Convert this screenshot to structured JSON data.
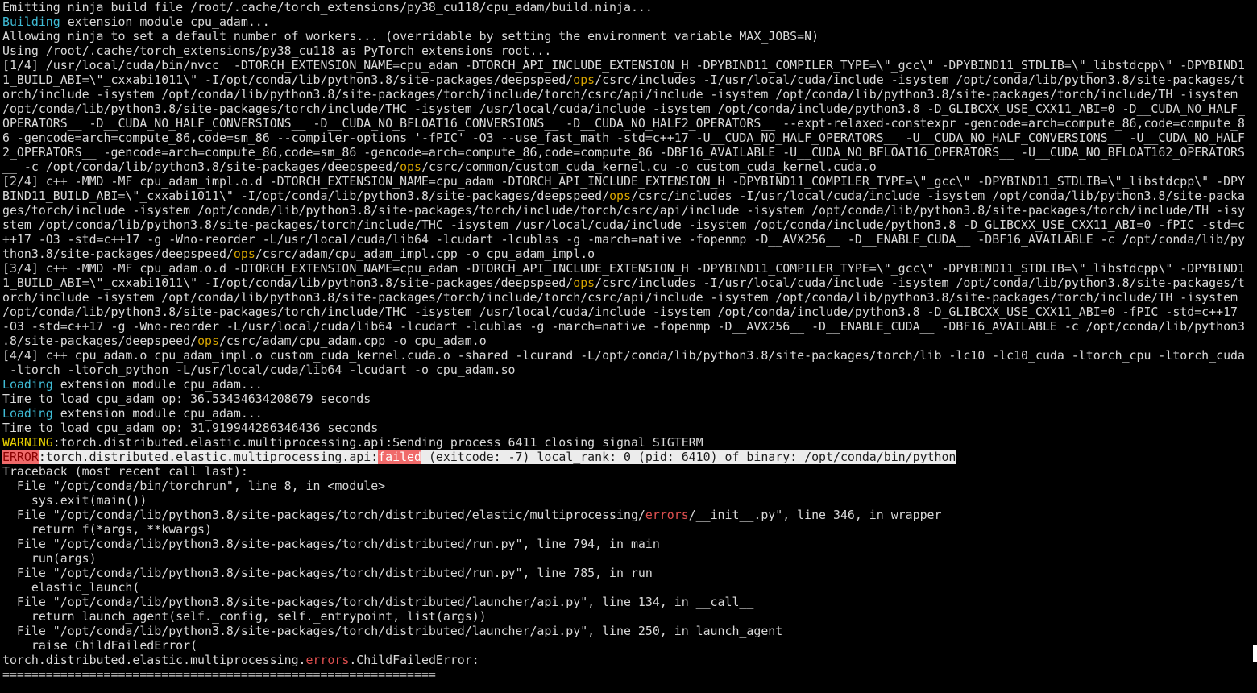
{
  "terminal": {
    "background": "#000000",
    "foreground": "#d9d9d9",
    "colors": {
      "building_loading": "#3fbcd6",
      "ops_keyword": "#d7a500",
      "warning": "#e8d000",
      "error_highlight": "#f06a6a",
      "errors_keyword": "#e05050"
    },
    "lines": [
      {
        "segments": [
          {
            "t": "Emitting ninja build file /root/.cache/torch_extensions/py38_cu118/cpu_adam/build.ninja..."
          }
        ]
      },
      {
        "segments": [
          {
            "t": "Building",
            "c": "cyan"
          },
          {
            "t": " extension module cpu_adam..."
          }
        ]
      },
      {
        "segments": [
          {
            "t": "Allowing ninja to set a default number of workers... (overridable by setting the environment variable MAX_JOBS=N)"
          }
        ]
      },
      {
        "segments": [
          {
            "t": "Using /root/.cache/torch_extensions/py38_cu118 as PyTorch extensions root..."
          }
        ]
      },
      {
        "segments": [
          {
            "t": "[1/4] /usr/local/cuda/bin/nvcc  -DTORCH_EXTENSION_NAME=cpu_adam -DTORCH_API_INCLUDE_EXTENSION_H -DPYBIND11_COMPILER_TYPE=\\\"_gcc\\\" -DPYBIND11_STDLIB=\\\"_libstdcpp\\\" -DPYBIND1"
          }
        ]
      },
      {
        "segments": [
          {
            "t": "1_BUILD_ABI=\\\"_cxxabi1011\\\" -I/opt/conda/lib/python3.8/site-packages/deepspeed/"
          },
          {
            "t": "ops",
            "c": "orange"
          },
          {
            "t": "/csrc/includes -I/usr/local/cuda/include -isystem /opt/conda/lib/python3.8/site-packages/t"
          }
        ]
      },
      {
        "segments": [
          {
            "t": "orch/include -isystem /opt/conda/lib/python3.8/site-packages/torch/include/torch/csrc/api/include -isystem /opt/conda/lib/python3.8/site-packages/torch/include/TH -isystem"
          }
        ]
      },
      {
        "segments": [
          {
            "t": "/opt/conda/lib/python3.8/site-packages/torch/include/THC -isystem /usr/local/cuda/include -isystem /opt/conda/include/python3.8 -D_GLIBCXX_USE_CXX11_ABI=0 -D__CUDA_NO_HALF_"
          }
        ]
      },
      {
        "segments": [
          {
            "t": "OPERATORS__ -D__CUDA_NO_HALF_CONVERSIONS__ -D__CUDA_NO_BFLOAT16_CONVERSIONS__ -D__CUDA_NO_HALF2_OPERATORS__ --expt-relaxed-constexpr -gencode=arch=compute_86,code=compute_8"
          }
        ]
      },
      {
        "segments": [
          {
            "t": "6 -gencode=arch=compute_86,code=sm_86 --compiler-options '-fPIC' -O3 --use_fast_math -std=c++17 -U__CUDA_NO_HALF_OPERATORS__ -U__CUDA_NO_HALF_CONVERSIONS__ -U__CUDA_NO_HALF"
          }
        ]
      },
      {
        "segments": [
          {
            "t": "2_OPERATORS__ -gencode=arch=compute_86,code=sm_86 -gencode=arch=compute_86,code=compute_86 -DBF16_AVAILABLE -U__CUDA_NO_BFLOAT16_OPERATORS__ -U__CUDA_NO_BFLOAT162_OPERATORS"
          }
        ]
      },
      {
        "segments": [
          {
            "t": "__ -c /opt/conda/lib/python3.8/site-packages/deepspeed/"
          },
          {
            "t": "ops",
            "c": "orange"
          },
          {
            "t": "/csrc/common/custom_cuda_kernel.cu -o custom_cuda_kernel.cuda.o"
          }
        ]
      },
      {
        "segments": [
          {
            "t": "[2/4] c++ -MMD -MF cpu_adam_impl.o.d -DTORCH_EXTENSION_NAME=cpu_adam -DTORCH_API_INCLUDE_EXTENSION_H -DPYBIND11_COMPILER_TYPE=\\\"_gcc\\\" -DPYBIND11_STDLIB=\\\"_libstdcpp\\\" -DPY"
          }
        ]
      },
      {
        "segments": [
          {
            "t": "BIND11_BUILD_ABI=\\\"_cxxabi1011\\\" -I/opt/conda/lib/python3.8/site-packages/deepspeed/"
          },
          {
            "t": "ops",
            "c": "orange"
          },
          {
            "t": "/csrc/includes -I/usr/local/cuda/include -isystem /opt/conda/lib/python3.8/site-packa"
          }
        ]
      },
      {
        "segments": [
          {
            "t": "ges/torch/include -isystem /opt/conda/lib/python3.8/site-packages/torch/include/torch/csrc/api/include -isystem /opt/conda/lib/python3.8/site-packages/torch/include/TH -isy"
          }
        ]
      },
      {
        "segments": [
          {
            "t": "stem /opt/conda/lib/python3.8/site-packages/torch/include/THC -isystem /usr/local/cuda/include -isystem /opt/conda/include/python3.8 -D_GLIBCXX_USE_CXX11_ABI=0 -fPIC -std=c"
          }
        ]
      },
      {
        "segments": [
          {
            "t": "++17 -O3 -std=c++17 -g -Wno-reorder -L/usr/local/cuda/lib64 -lcudart -lcublas -g -march=native -fopenmp -D__AVX256__ -D__ENABLE_CUDA__ -DBF16_AVAILABLE -c /opt/conda/lib/py"
          }
        ]
      },
      {
        "segments": [
          {
            "t": "thon3.8/site-packages/deepspeed/"
          },
          {
            "t": "ops",
            "c": "orange"
          },
          {
            "t": "/csrc/adam/cpu_adam_impl.cpp -o cpu_adam_impl.o"
          }
        ]
      },
      {
        "segments": [
          {
            "t": "[3/4] c++ -MMD -MF cpu_adam.o.d -DTORCH_EXTENSION_NAME=cpu_adam -DTORCH_API_INCLUDE_EXTENSION_H -DPYBIND11_COMPILER_TYPE=\\\"_gcc\\\" -DPYBIND11_STDLIB=\\\"_libstdcpp\\\" -DPYBIND1"
          }
        ]
      },
      {
        "segments": [
          {
            "t": "1_BUILD_ABI=\\\"_cxxabi1011\\\" -I/opt/conda/lib/python3.8/site-packages/deepspeed/"
          },
          {
            "t": "ops",
            "c": "orange"
          },
          {
            "t": "/csrc/includes -I/usr/local/cuda/include -isystem /opt/conda/lib/python3.8/site-packages/t"
          }
        ]
      },
      {
        "segments": [
          {
            "t": "orch/include -isystem /opt/conda/lib/python3.8/site-packages/torch/include/torch/csrc/api/include -isystem /opt/conda/lib/python3.8/site-packages/torch/include/TH -isystem"
          }
        ]
      },
      {
        "segments": [
          {
            "t": "/opt/conda/lib/python3.8/site-packages/torch/include/THC -isystem /usr/local/cuda/include -isystem /opt/conda/include/python3.8 -D_GLIBCXX_USE_CXX11_ABI=0 -fPIC -std=c++17"
          }
        ]
      },
      {
        "segments": [
          {
            "t": "-O3 -std=c++17 -g -Wno-reorder -L/usr/local/cuda/lib64 -lcudart -lcublas -g -march=native -fopenmp -D__AVX256__ -D__ENABLE_CUDA__ -DBF16_AVAILABLE -c /opt/conda/lib/python3"
          }
        ]
      },
      {
        "segments": [
          {
            "t": ".8/site-packages/deepspeed/"
          },
          {
            "t": "ops",
            "c": "orange"
          },
          {
            "t": "/csrc/adam/cpu_adam.cpp -o cpu_adam.o"
          }
        ]
      },
      {
        "segments": [
          {
            "t": "[4/4] c++ cpu_adam.o cpu_adam_impl.o custom_cuda_kernel.cuda.o -shared -lcurand -L/opt/conda/lib/python3.8/site-packages/torch/lib -lc10 -lc10_cuda -ltorch_cpu -ltorch_cuda"
          }
        ]
      },
      {
        "segments": [
          {
            "t": " -ltorch -ltorch_python -L/usr/local/cuda/lib64 -lcudart -o cpu_adam.so"
          }
        ]
      },
      {
        "segments": [
          {
            "t": "Loading",
            "c": "cyan"
          },
          {
            "t": " extension module cpu_adam..."
          }
        ]
      },
      {
        "segments": [
          {
            "t": "Time to load cpu_adam op: 36.53434634208679 seconds"
          }
        ]
      },
      {
        "segments": [
          {
            "t": "Loading",
            "c": "cyan"
          },
          {
            "t": " extension module cpu_adam..."
          }
        ]
      },
      {
        "segments": [
          {
            "t": "Time to load cpu_adam op: 31.919944286346436 seconds"
          }
        ]
      },
      {
        "segments": [
          {
            "t": "WARNING",
            "c": "yellow"
          },
          {
            "t": ":torch.distributed.elastic.multiprocessing.api:Sending process 6411 closing signal SIGTERM"
          }
        ]
      },
      {
        "segments": [
          {
            "t": "ERROR",
            "c": "err-hl"
          },
          {
            "t": ":torch.distributed.elastic.multiprocessing.api:",
            "c": "hl"
          },
          {
            "t": "failed",
            "c": "fail-hl"
          },
          {
            "t": " (exitcode: -7) local_rank: 0 (pid: 6410) of binary: /opt/conda/bin/python",
            "c": "hl"
          }
        ]
      },
      {
        "segments": [
          {
            "t": "Traceback (most recent call last):"
          }
        ]
      },
      {
        "segments": [
          {
            "t": "  File \"/opt/conda/bin/torchrun\", line 8, in <module>"
          }
        ]
      },
      {
        "segments": [
          {
            "t": "    sys.exit(main())"
          }
        ]
      },
      {
        "segments": [
          {
            "t": "  File \"/opt/conda/lib/python3.8/site-packages/torch/distributed/elastic/multiprocessing/"
          },
          {
            "t": "errors",
            "c": "red"
          },
          {
            "t": "/__init__.py\", line 346, in wrapper"
          }
        ]
      },
      {
        "segments": [
          {
            "t": "    return f(*args, **kwargs)"
          }
        ]
      },
      {
        "segments": [
          {
            "t": "  File \"/opt/conda/lib/python3.8/site-packages/torch/distributed/run.py\", line 794, in main"
          }
        ]
      },
      {
        "segments": [
          {
            "t": "    run(args)"
          }
        ]
      },
      {
        "segments": [
          {
            "t": "  File \"/opt/conda/lib/python3.8/site-packages/torch/distributed/run.py\", line 785, in run"
          }
        ]
      },
      {
        "segments": [
          {
            "t": "    elastic_launch("
          }
        ]
      },
      {
        "segments": [
          {
            "t": "  File \"/opt/conda/lib/python3.8/site-packages/torch/distributed/launcher/api.py\", line 134, in __call__"
          }
        ]
      },
      {
        "segments": [
          {
            "t": "    return launch_agent(self._config, self._entrypoint, list(args))"
          }
        ]
      },
      {
        "segments": [
          {
            "t": "  File \"/opt/conda/lib/python3.8/site-packages/torch/distributed/launcher/api.py\", line 250, in launch_agent"
          }
        ]
      },
      {
        "segments": [
          {
            "t": "    raise ChildFailedError("
          }
        ]
      },
      {
        "segments": [
          {
            "t": "torch.distributed.elastic.multiprocessing."
          },
          {
            "t": "errors",
            "c": "red"
          },
          {
            "t": ".ChildFailedError:"
          }
        ]
      },
      {
        "segments": [
          {
            "t": "============================================================"
          }
        ]
      }
    ]
  }
}
